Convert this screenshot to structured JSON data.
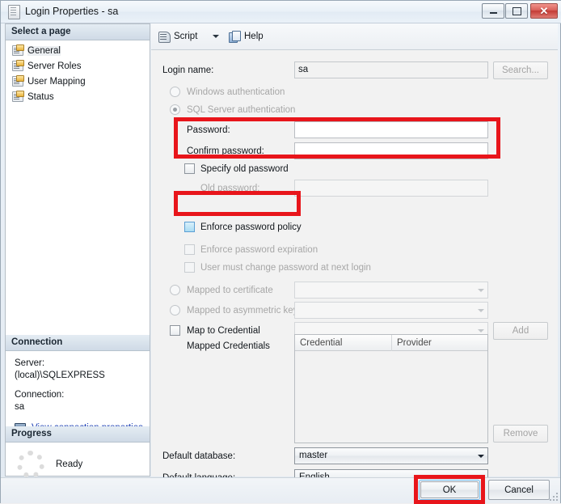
{
  "window": {
    "title": "Login Properties - sa",
    "icon": "page-icon",
    "buttons": {
      "minimize": "minimize",
      "maximize": "maximize",
      "close": "✕"
    }
  },
  "sidebar": {
    "header": "Select a page",
    "items": [
      {
        "label": "General",
        "selected": true
      },
      {
        "label": "Server Roles",
        "selected": false
      },
      {
        "label": "User Mapping",
        "selected": false
      },
      {
        "label": "Status",
        "selected": false
      }
    ],
    "connection": {
      "header": "Connection",
      "server_label": "Server:",
      "server_value": "(local)\\SQLEXPRESS",
      "connection_label": "Connection:",
      "connection_value": "sa",
      "link": "View connection properties"
    },
    "progress": {
      "header": "Progress",
      "status": "Ready"
    }
  },
  "toolbar": {
    "script_label": "Script",
    "help_label": "Help"
  },
  "form": {
    "login_name_label": "Login name:",
    "login_name_value": "sa",
    "search_button": "Search...",
    "windows_auth_label": "Windows authentication",
    "sql_auth_label": "SQL Server authentication",
    "password_label": "Password:",
    "password_value": "",
    "confirm_password_label": "Confirm password:",
    "confirm_password_value": "",
    "specify_old_password_label": "Specify old password",
    "old_password_label": "Old password:",
    "old_password_value": "",
    "enforce_password_policy_label": "Enforce password policy",
    "enforce_password_expiration_label": "Enforce password expiration",
    "user_must_change_label": "User must change password at next login",
    "mapped_to_certificate_label": "Mapped to certificate",
    "mapped_to_certificate_value": "",
    "mapped_to_asymmetric_key_label": "Mapped to asymmetric key",
    "mapped_to_asymmetric_key_value": "",
    "map_to_credential_label": "Map to Credential",
    "map_to_credential_value": "",
    "add_button": "Add",
    "mapped_credentials_label": "Mapped Credentials",
    "grid_columns": [
      "Credential",
      "Provider"
    ],
    "grid_rows": [],
    "remove_button": "Remove",
    "default_database_label": "Default database:",
    "default_database_value": "master",
    "default_language_label": "Default language:",
    "default_language_value": "English"
  },
  "footer": {
    "ok_button": "OK",
    "cancel_button": "Cancel"
  },
  "annotations": {
    "color": "#e8151b",
    "boxes": [
      "password-fields",
      "enforce-password-policy",
      "ok-button"
    ]
  }
}
